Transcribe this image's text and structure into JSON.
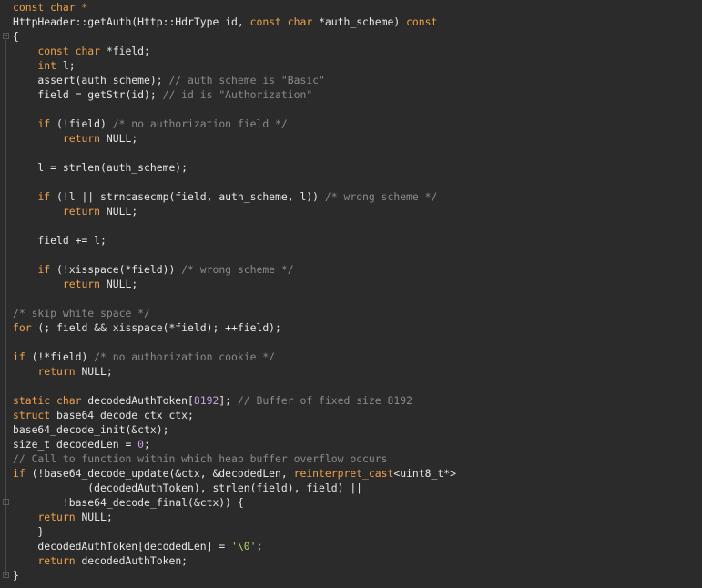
{
  "editor": {
    "lines": [
      [
        {
          "t": "const char *",
          "c": "kw"
        }
      ],
      [
        {
          "t": "HttpHeader::getAuth(Http::HdrType id, ",
          "c": "pun"
        },
        {
          "t": "const char",
          "c": "kw"
        },
        {
          "t": " *auth_scheme) ",
          "c": "pun"
        },
        {
          "t": "const",
          "c": "kw"
        }
      ],
      [
        {
          "t": "{",
          "c": "pun"
        }
      ],
      [
        {
          "t": "    ",
          "c": "pun"
        },
        {
          "t": "const char",
          "c": "kw"
        },
        {
          "t": " *field;",
          "c": "pun"
        }
      ],
      [
        {
          "t": "    ",
          "c": "pun"
        },
        {
          "t": "int",
          "c": "kw"
        },
        {
          "t": " l;",
          "c": "pun"
        }
      ],
      [
        {
          "t": "    assert(auth_scheme); ",
          "c": "pun"
        },
        {
          "t": "// auth_scheme is \"Basic\"",
          "c": "cm"
        }
      ],
      [
        {
          "t": "    field = getStr(id); ",
          "c": "pun"
        },
        {
          "t": "// id is \"Authorization\"",
          "c": "cm"
        }
      ],
      [
        {
          "t": "",
          "c": "pun"
        }
      ],
      [
        {
          "t": "    ",
          "c": "pun"
        },
        {
          "t": "if",
          "c": "kw"
        },
        {
          "t": " (!field) ",
          "c": "pun"
        },
        {
          "t": "/* no authorization field */",
          "c": "cm"
        }
      ],
      [
        {
          "t": "        ",
          "c": "pun"
        },
        {
          "t": "return",
          "c": "kw"
        },
        {
          "t": " NULL;",
          "c": "pun"
        }
      ],
      [
        {
          "t": "",
          "c": "pun"
        }
      ],
      [
        {
          "t": "    l = strlen(auth_scheme);",
          "c": "pun"
        }
      ],
      [
        {
          "t": "",
          "c": "pun"
        }
      ],
      [
        {
          "t": "    ",
          "c": "pun"
        },
        {
          "t": "if",
          "c": "kw"
        },
        {
          "t": " (!l || strncasecmp(field, auth_scheme, l)) ",
          "c": "pun"
        },
        {
          "t": "/* wrong scheme */",
          "c": "cm"
        }
      ],
      [
        {
          "t": "        ",
          "c": "pun"
        },
        {
          "t": "return",
          "c": "kw"
        },
        {
          "t": " NULL;",
          "c": "pun"
        }
      ],
      [
        {
          "t": "",
          "c": "pun"
        }
      ],
      [
        {
          "t": "    field += l;",
          "c": "pun"
        }
      ],
      [
        {
          "t": "",
          "c": "pun"
        }
      ],
      [
        {
          "t": "    ",
          "c": "pun"
        },
        {
          "t": "if",
          "c": "kw"
        },
        {
          "t": " (!xisspace(*field)) ",
          "c": "pun"
        },
        {
          "t": "/* wrong scheme */",
          "c": "cm"
        }
      ],
      [
        {
          "t": "        ",
          "c": "pun"
        },
        {
          "t": "return",
          "c": "kw"
        },
        {
          "t": " NULL;",
          "c": "pun"
        }
      ],
      [
        {
          "t": "",
          "c": "pun"
        }
      ],
      [
        {
          "t": "/* skip white space */",
          "c": "cm"
        }
      ],
      [
        {
          "t": "for",
          "c": "kw"
        },
        {
          "t": " (; field && xisspace(*field); ++field);",
          "c": "pun"
        }
      ],
      [
        {
          "t": "",
          "c": "pun"
        }
      ],
      [
        {
          "t": "if",
          "c": "kw"
        },
        {
          "t": " (!*field) ",
          "c": "pun"
        },
        {
          "t": "/* no authorization cookie */",
          "c": "cm"
        }
      ],
      [
        {
          "t": "    ",
          "c": "pun"
        },
        {
          "t": "return",
          "c": "kw"
        },
        {
          "t": " NULL;",
          "c": "pun"
        }
      ],
      [
        {
          "t": "",
          "c": "pun"
        }
      ],
      [
        {
          "t": "static char",
          "c": "kw"
        },
        {
          "t": " decodedAuthToken[",
          "c": "pun"
        },
        {
          "t": "8192",
          "c": "num"
        },
        {
          "t": "]; ",
          "c": "pun"
        },
        {
          "t": "// Buffer of fixed size 8192",
          "c": "cm"
        }
      ],
      [
        {
          "t": "struct",
          "c": "kw"
        },
        {
          "t": " base64_decode_ctx ctx;",
          "c": "pun"
        }
      ],
      [
        {
          "t": "base64_decode_init(&ctx);",
          "c": "pun"
        }
      ],
      [
        {
          "t": "size_t decodedLen = ",
          "c": "pun"
        },
        {
          "t": "0",
          "c": "num"
        },
        {
          "t": ";",
          "c": "pun"
        }
      ],
      [
        {
          "t": "// Call to function within which heap buffer overflow occurs",
          "c": "cm"
        }
      ],
      [
        {
          "t": "if",
          "c": "kw"
        },
        {
          "t": " (!base64_decode_update(&ctx, &decodedLen, ",
          "c": "pun"
        },
        {
          "t": "reinterpret_cast",
          "c": "kw"
        },
        {
          "t": "<uint8_t*>",
          "c": "pun"
        }
      ],
      [
        {
          "t": "            (decodedAuthToken), strlen(field), field) ||",
          "c": "pun"
        }
      ],
      [
        {
          "t": "        !base64_decode_final(&ctx)) {",
          "c": "pun"
        }
      ],
      [
        {
          "t": "    ",
          "c": "pun"
        },
        {
          "t": "return",
          "c": "kw"
        },
        {
          "t": " NULL;",
          "c": "pun"
        }
      ],
      [
        {
          "t": "    }",
          "c": "pun"
        }
      ],
      [
        {
          "t": "    decodedAuthToken[decodedLen] = ",
          "c": "pun"
        },
        {
          "t": "'\\0'",
          "c": "str"
        },
        {
          "t": ";",
          "c": "pun"
        }
      ],
      [
        {
          "t": "    ",
          "c": "pun"
        },
        {
          "t": "return",
          "c": "kw"
        },
        {
          "t": " decodedAuthToken;",
          "c": "pun"
        }
      ],
      [
        {
          "t": "}",
          "c": "pun"
        }
      ]
    ]
  }
}
